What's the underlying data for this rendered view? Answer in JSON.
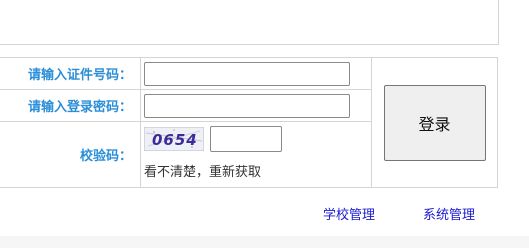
{
  "form": {
    "cert_label": "请输入证件号码：",
    "password_label": "请输入登录密码：",
    "captcha_label": "校验码：",
    "cert_value": "",
    "password_value": "",
    "captcha_value": "",
    "captcha_code": "0654",
    "refresh_text": "看不清楚，重新获取",
    "login_label": "登录"
  },
  "footer_links": {
    "school_admin": "学校管理",
    "system_admin": "系统管理"
  },
  "colors": {
    "label": "#2a8fd8",
    "link": "#1a1ad0",
    "captcha_text": "#3a2a9a"
  }
}
